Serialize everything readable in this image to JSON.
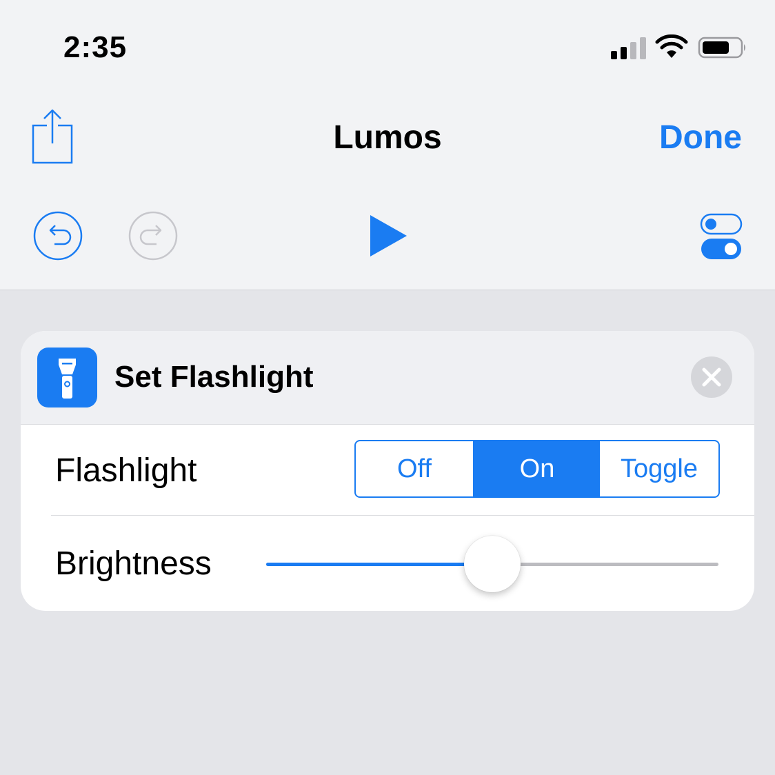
{
  "status_bar": {
    "time": "2:35",
    "icons": [
      "cellular-signal-icon",
      "wifi-icon",
      "battery-icon"
    ]
  },
  "nav": {
    "title": "Lumos",
    "done_label": "Done",
    "share_icon": "share-icon"
  },
  "toolbar": {
    "undo_icon": "undo-icon",
    "redo_icon": "redo-icon",
    "play_icon": "play-icon",
    "settings_icon": "toggle-settings-icon",
    "redo_enabled": false
  },
  "action_card": {
    "icon": "flashlight-icon",
    "title": "Set Flashlight",
    "remove_icon": "close-icon",
    "flashlight": {
      "label": "Flashlight",
      "options": [
        "Off",
        "On",
        "Toggle"
      ],
      "selected": "On"
    },
    "brightness": {
      "label": "Brightness",
      "value": 0.5
    }
  },
  "colors": {
    "accent": "#1a7cf2",
    "background": "#e4e5e9",
    "bar": "#f2f3f5",
    "disabled": "#c7c7cc"
  }
}
